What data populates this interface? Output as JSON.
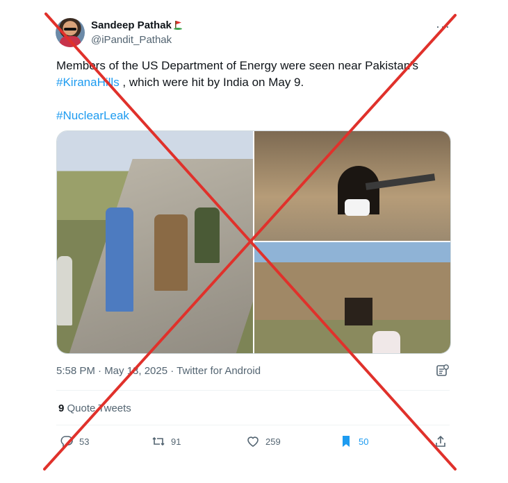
{
  "user": {
    "display_name": "Sandeep Pathak",
    "handle": "@iPandit_Pathak"
  },
  "tweet": {
    "text_prefix": "Members of the US Department of Energy were seen near Pakistan's",
    "hashtag_1": "#KiranaHills",
    "text_suffix": " , which were hit by India on May 9.",
    "hashtag_2": "#NuclearLeak"
  },
  "meta": {
    "timestamp": "5:58 PM · May 13, 2025 · Twitter for Android"
  },
  "quote_tweets": {
    "count": "9",
    "label": "Quote Tweets"
  },
  "actions": {
    "replies": "53",
    "retweets": "91",
    "likes": "259",
    "bookmarks": "50"
  },
  "colors": {
    "accent": "#1d9bf0",
    "muted": "#536471",
    "cross": "#e0312b"
  }
}
